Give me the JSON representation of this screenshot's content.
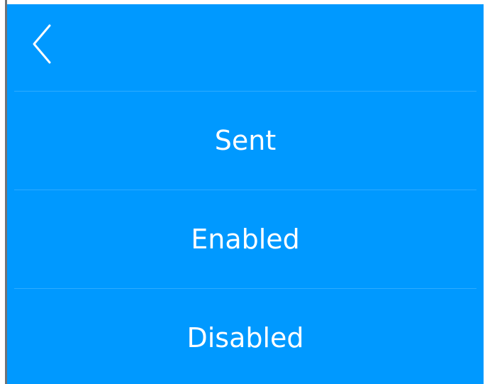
{
  "colors": {
    "background": "#0099ff",
    "text": "#ffffff"
  },
  "header": {
    "back_icon": "chevron-left-icon"
  },
  "menu": {
    "items": [
      {
        "label": "Sent"
      },
      {
        "label": "Enabled"
      },
      {
        "label": "Disabled"
      }
    ]
  }
}
